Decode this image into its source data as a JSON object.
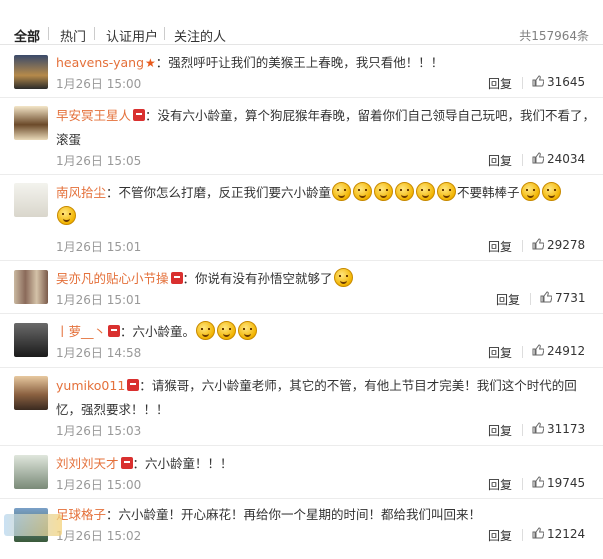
{
  "tabs": {
    "all": "全部",
    "hot": "热门",
    "verified": "认证用户",
    "following": "关注的人"
  },
  "total": "共157964条",
  "comments": [
    {
      "user": "heavens-yang",
      "text": "：强烈呼吁让我们的美猴王上春晚，我只看他！！！",
      "time": "1月26日 15:00",
      "reply": "回复",
      "likes": "31645"
    },
    {
      "user": "早安冥王星人",
      "text": "：没有六小龄童，算个狗屁猴年春晚，留着你们自己领导自己玩吧，我们不看了，",
      "text2": "滚蛋",
      "time": "1月26日 15:05",
      "reply": "回复",
      "likes": "24034"
    },
    {
      "user": "南风拾尘",
      "text": "：不管你怎么打磨，反正我们要六小龄童",
      "text_b": "不要韩棒子",
      "time": "1月26日 15:01",
      "reply": "回复",
      "likes": "29278"
    },
    {
      "user": "吴亦凡的贴心小节操",
      "text": "：你说有没有孙悟空就够了",
      "time": "1月26日 15:01",
      "reply": "回复",
      "likes": "7731"
    },
    {
      "user": "丨萝__丶",
      "text": "：六小龄童。",
      "time": "1月26日 14:58",
      "reply": "回复",
      "likes": "24912"
    },
    {
      "user": "yumiko011",
      "text": "：请猴哥，六小龄童老师，其它的不管，有他上节目才完美！我们这个时代的回",
      "text2": "忆，强烈要求！！！",
      "time": "1月26日 15:03",
      "reply": "回复",
      "likes": "31173"
    },
    {
      "user": "刘刘刘天才",
      "text": "：六小龄童！！！",
      "time": "1月26日 15:00",
      "reply": "回复",
      "likes": "19745"
    },
    {
      "user": "足球格子",
      "text": "：六小龄童！开心麻花！再给你一个星期的时间！都给我们叫回来！",
      "time": "1月26日 15:02",
      "reply": "回复",
      "likes": "12124"
    }
  ]
}
